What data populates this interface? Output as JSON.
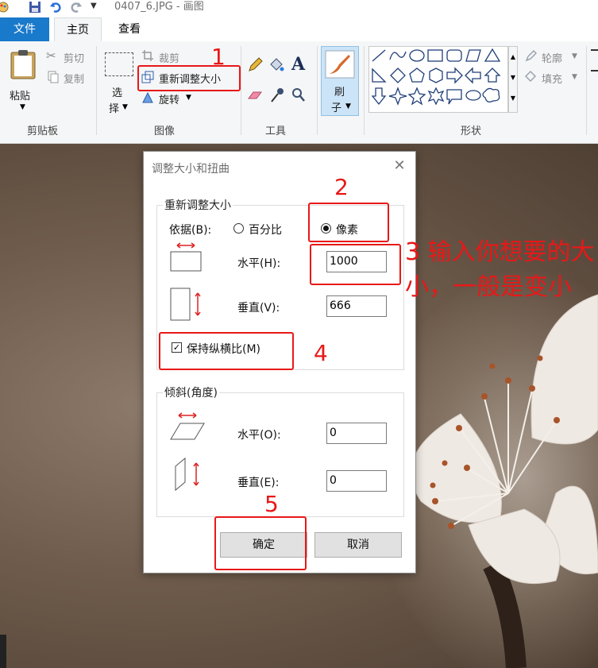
{
  "window": {
    "title": "0407_6.JPG - 画图"
  },
  "quick_access": {
    "icons": [
      "paint-app-icon",
      "save-icon",
      "undo-icon",
      "redo-icon",
      "customize-dropdown-icon"
    ]
  },
  "tabs": {
    "file": "文件",
    "home": "主页",
    "view": "查看"
  },
  "ribbon": {
    "clipboard": {
      "paste": "粘贴",
      "cut": "剪切",
      "copy": "复制",
      "group": "剪贴板"
    },
    "image": {
      "select_1": "选",
      "select_2": "择",
      "crop": "裁剪",
      "resize": "重新调整大小",
      "rotate": "旋转",
      "group": "图像"
    },
    "tools": {
      "group": "工具"
    },
    "brushes": {
      "label_1": "刷",
      "label_2": "子"
    },
    "shapes": {
      "outline": "轮廓",
      "fill": "填充",
      "group": "形状"
    }
  },
  "dialog": {
    "title": "调整大小和扭曲",
    "resize_legend": "重新调整大小",
    "by_label": "依据(B):",
    "percent_option": "百分比",
    "pixels_option": "像素",
    "selected_option": "pixels",
    "horizontal_label": "水平(H):",
    "horizontal_value": "1000",
    "vertical_label": "垂直(V):",
    "vertical_value": "666",
    "keep_aspect_label": "保持纵横比(M)",
    "keep_aspect_checked": true,
    "skew_legend": "倾斜(角度)",
    "skew_h_label": "水平(O):",
    "skew_h_value": "0",
    "skew_v_label": "垂直(E):",
    "skew_v_value": "0",
    "ok": "确定",
    "cancel": "取消"
  },
  "annotations": {
    "step1": "1",
    "step2": "2",
    "step3_prefix": "3",
    "step3_note": "3 输入你想要的大小，一般是变小",
    "step4": "4",
    "step5": "5",
    "color": "#e81818"
  },
  "colors": {
    "file_tab": "#1979ca",
    "ribbon_bg": "#f5f6f7",
    "annotation_red": "#e81818"
  }
}
